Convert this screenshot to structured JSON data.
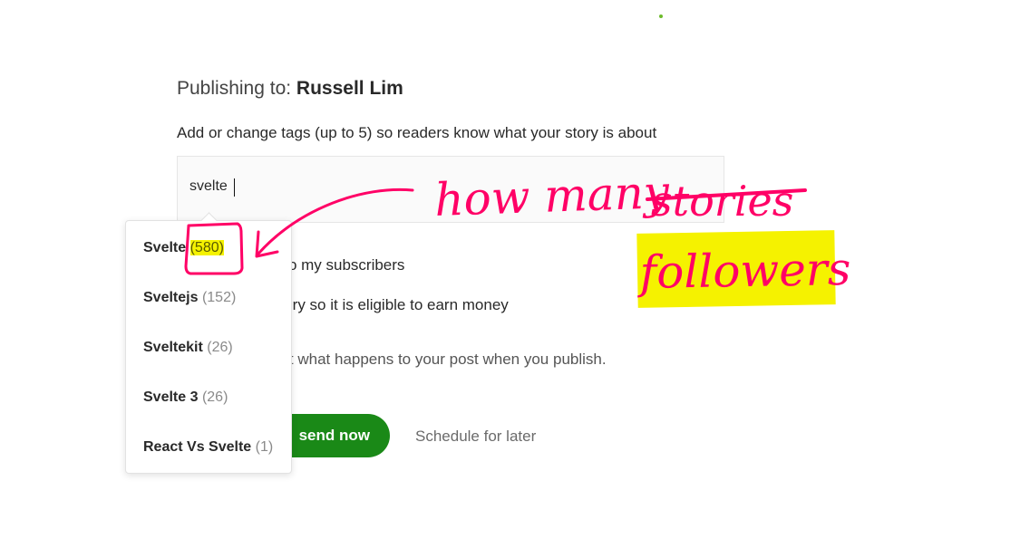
{
  "publishing": {
    "prefix": "Publishing to: ",
    "name": "Russell Lim"
  },
  "instructions": "Add or change tags (up to 5) so readers know what your story is about",
  "tag_input": {
    "value": "svelte"
  },
  "options": {
    "send_subscribers": "k to my subscribers",
    "earn_money": "story so it is eligible to earn money"
  },
  "publish_note": "out what happens to your post when you publish.",
  "actions": {
    "send_now_label": "send now",
    "schedule_label": "Schedule for later"
  },
  "dropdown": {
    "items": [
      {
        "name": "Svelte",
        "count": "(580)"
      },
      {
        "name": "Sveltejs",
        "count": "(152)"
      },
      {
        "name": "Sveltekit",
        "count": "(26)"
      },
      {
        "name": "Svelte 3",
        "count": "(26)"
      },
      {
        "name": "React Vs Svelte",
        "count": "(1)"
      }
    ]
  },
  "annotation": {
    "line1_prefix": "how many",
    "struck_word": "stories",
    "replacement": "followers",
    "ink_color": "#ff0066",
    "highlight_color": "#f5f200"
  }
}
